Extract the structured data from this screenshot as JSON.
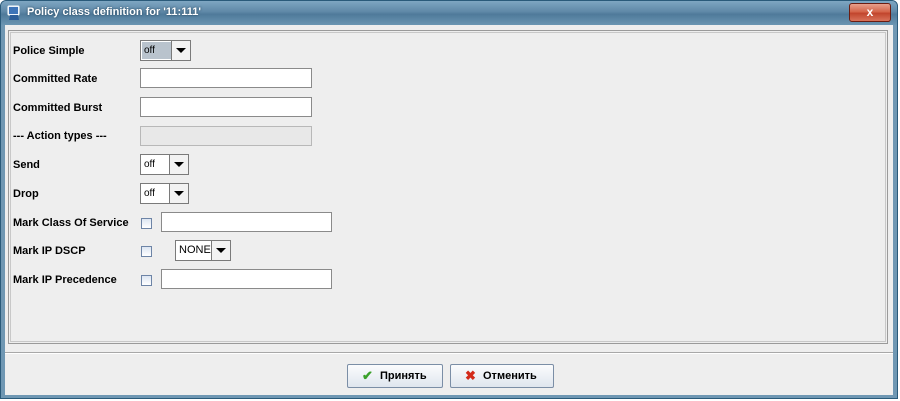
{
  "window": {
    "title": "Policy class definition for '11:111'",
    "close_glyph": "x"
  },
  "form": {
    "police_simple": {
      "label": "Police Simple",
      "value": "off"
    },
    "committed_rate": {
      "label": "Committed Rate",
      "value": ""
    },
    "committed_burst": {
      "label": "Committed Burst",
      "value": ""
    },
    "action_types": {
      "label": "--- Action types ---",
      "value": ""
    },
    "send": {
      "label": "Send",
      "value": "off"
    },
    "drop": {
      "label": "Drop",
      "value": "off"
    },
    "mark_cos": {
      "label": "Mark Class Of Service",
      "checked": false,
      "value": ""
    },
    "mark_dscp": {
      "label": "Mark IP DSCP",
      "checked": false,
      "value": "NONE"
    },
    "mark_precedence": {
      "label": "Mark IP Precedence",
      "checked": false,
      "value": ""
    }
  },
  "buttons": {
    "accept": {
      "label": "Принять",
      "icon": "checkmark-icon",
      "icon_color": "#3aa02a"
    },
    "cancel": {
      "label": "Отменить",
      "icon": "cross-icon",
      "icon_color": "#d32a1a"
    }
  }
}
